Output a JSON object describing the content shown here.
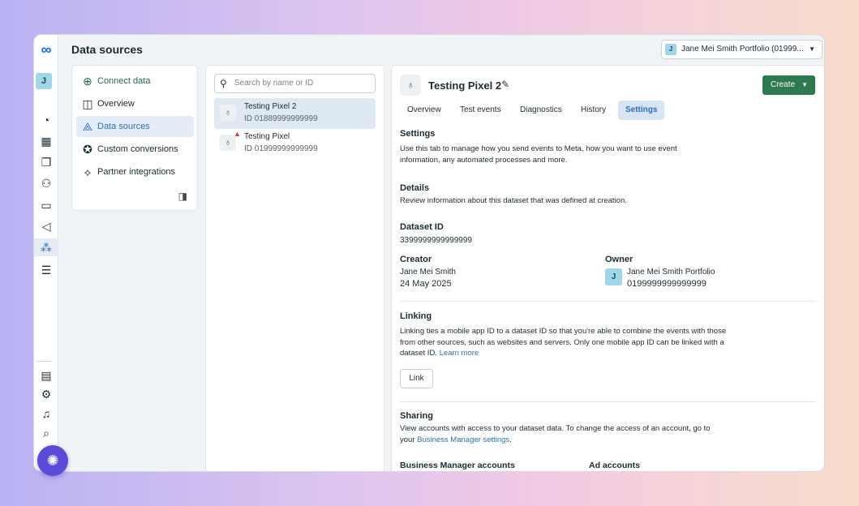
{
  "header": {
    "title": "Data sources",
    "portfolio_label": "Jane Mei Smith Portfolio (01999...",
    "portfolio_avatar": "J"
  },
  "rail": {
    "account_initial": "J",
    "logo": "∞"
  },
  "nav": {
    "items": [
      {
        "label": "Connect data",
        "icon": "plus-circle-icon"
      },
      {
        "label": "Overview",
        "icon": "overview-grid-icon"
      },
      {
        "label": "Data sources",
        "icon": "data-sources-icon"
      },
      {
        "label": "Custom conversions",
        "icon": "star-badge-icon"
      },
      {
        "label": "Partner integrations",
        "icon": "handshake-icon"
      }
    ]
  },
  "search": {
    "placeholder": "Search by name or ID"
  },
  "pixels": [
    {
      "name": "Testing Pixel 2",
      "id": "ID 01889999999999"
    },
    {
      "name": "Testing Pixel",
      "id": "ID 01999999999999"
    }
  ],
  "detail": {
    "title": "Testing Pixel 2",
    "create_label": "Create",
    "tabs": [
      "Overview",
      "Test events",
      "Diagnostics",
      "History",
      "Settings"
    ],
    "settings": {
      "heading": "Settings",
      "text": "Use this tab to manage how you send events to Meta, how you want to use event information, any automated processes and more."
    },
    "details": {
      "heading": "Details",
      "text": "Review information about this dataset that was defined at creation."
    },
    "dataset_id": {
      "label": "Dataset ID",
      "value": "3399999999999999"
    },
    "creator": {
      "label": "Creator",
      "name": "Jane Mei Smith",
      "date": "24 May 2025"
    },
    "owner": {
      "label": "Owner",
      "name": "Jane Mei Smith Portfolio",
      "id": "0199999999999999",
      "avatar": "J"
    },
    "linking": {
      "heading": "Linking",
      "text": "Linking ties a mobile app ID to a dataset ID so that you're able to combine the events with those from other sources, such as websites and servers. Only one mobile app ID can be linked with a dataset ID.",
      "learn_more": "Learn more",
      "button": "Link"
    },
    "sharing": {
      "heading": "Sharing",
      "text": "View accounts with access to your dataset data. To change the access of an account, go to your",
      "link": "Business Manager settings",
      "suffix": "."
    },
    "bm_accounts": "Business Manager accounts",
    "ad_accounts": "Ad accounts"
  }
}
